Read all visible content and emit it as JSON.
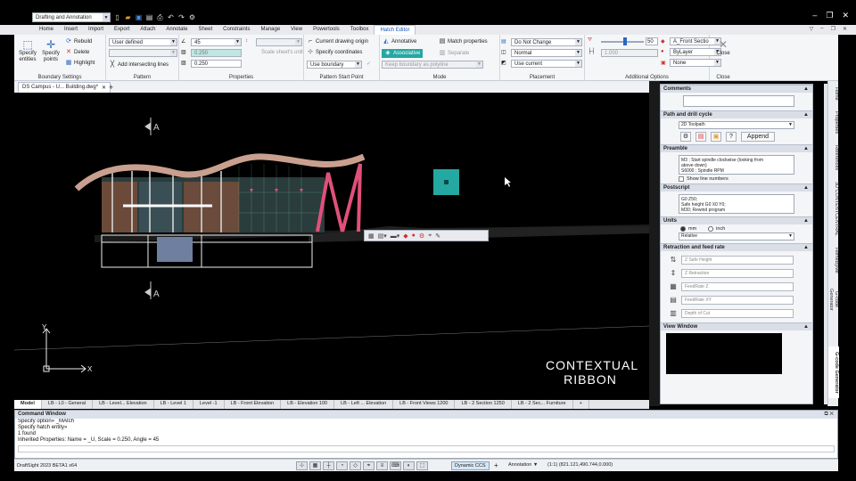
{
  "quick_access": {
    "workspace": "Drafting and Annotation"
  },
  "menu": {
    "items": [
      "Home",
      "Insert",
      "Import",
      "Export",
      "Attach",
      "Annotate",
      "Sheet",
      "Constraints",
      "Manage",
      "View",
      "Powertools",
      "Toolbox",
      "Hatch Editor"
    ],
    "active": "Hatch Editor"
  },
  "ribbon": {
    "boundary": {
      "title": "Boundary Settings",
      "specify_entities": "Specify entities",
      "specify_points": "Specify points",
      "rebuild": "Rebuild",
      "delete": "Delete",
      "highlight": "Highlight"
    },
    "pattern": {
      "title": "Pattern",
      "type": "User defined",
      "add_intersecting": "Add intersecting lines"
    },
    "properties": {
      "title": "Properties",
      "angle": "45",
      "spacing1": "0.250",
      "spacing2": "0.250",
      "scale_sheets_unit": "Scale sheet's unit"
    },
    "start_point": {
      "title": "Pattern Start Point",
      "current_origin": "Current drawing origin",
      "specify_coords": "Specify coordinates",
      "use_boundary": "Use boundary"
    },
    "mode": {
      "title": "Mode",
      "annotative": "Annotative",
      "associative": "Associative",
      "match_properties": "Match properties",
      "separate": "Separate",
      "keep_boundary": "Keep boundary as polyline"
    },
    "placement": {
      "title": "Placement",
      "do_not_change": "Do Not Change",
      "normal": "Normal",
      "use_current": "Use current"
    },
    "additional": {
      "title": "Additional Options",
      "slider_value": "50",
      "gap": "1.000",
      "layer": "A_Front Sectio",
      "color": "ByLayer",
      "background": "None"
    },
    "close": {
      "title": "Close",
      "label": "Close"
    }
  },
  "document_tab": "DS Campus - U... Building.dwg*",
  "canvas": {
    "marker_a": "A",
    "axis_x": "X",
    "axis_y": "Y",
    "context_line1": "CONTEXTUAL",
    "context_line2": "RIBBON"
  },
  "palette": {
    "comments": "Comments",
    "path_title": "Path and drill cycle",
    "toolpath": "2D Toolpath",
    "append": "Append",
    "preamble_title": "Preamble",
    "preamble_lines": [
      "M3    ; Start spindle clockwise (looking from",
      "above down)",
      "S6000  ; Spindle RPM"
    ],
    "show_line_numbers": "Show line numbers",
    "postscript_title": "Postscript",
    "postscript_lines": [
      "G0 Z50;",
      "Safe height G0 X0 Y0;",
      "M30; Rewind program"
    ],
    "units_title": "Units",
    "mm": "mm",
    "inch": "inch",
    "relative": "Relative",
    "retraction_title": "Retraction and feed rate",
    "fields": [
      "Z Safe Height",
      "Z Retraction",
      "FeedRate Z",
      "FeedRate XY",
      "Depth of Cut"
    ],
    "view_window": "View Window"
  },
  "vertical_tabs": [
    "Home",
    "Properties",
    "References",
    "3D CONTENTCENTRAL",
    "HomeByMe",
    "G-code Generator"
  ],
  "vertical_tab_active": "G-code Generator",
  "layout_tabs": [
    "Model",
    "LB - L0 - General",
    "LB - Level... Elevation",
    "LB - Level 1",
    "Level -1",
    "LB - Front Elevation",
    "LB - Elevation 100",
    "LB - Left ... Elevation",
    "LB - Front Views 1200",
    "LB - 2 Section 1250",
    "LB - 2 Sec... Furniture"
  ],
  "layout_active": "Model",
  "command": {
    "title": "Command Window",
    "lines": [
      "Specify option» _MAtch",
      "Specify hatch entity»",
      "1 found",
      "Inherited Properties: Name = _U, Scale = 0.250, Angle = 45"
    ]
  },
  "status": {
    "app": "DraftSight 2023 BETA1 x64",
    "dynamic_ccs": "Dynamic CCS",
    "annotation": "Annotation",
    "scale": "(1:1)",
    "coords": "(821.121,490.744,0.000)"
  },
  "colors": {
    "accent_teal": "#24a8a2",
    "building_pink": "#e0507a"
  }
}
